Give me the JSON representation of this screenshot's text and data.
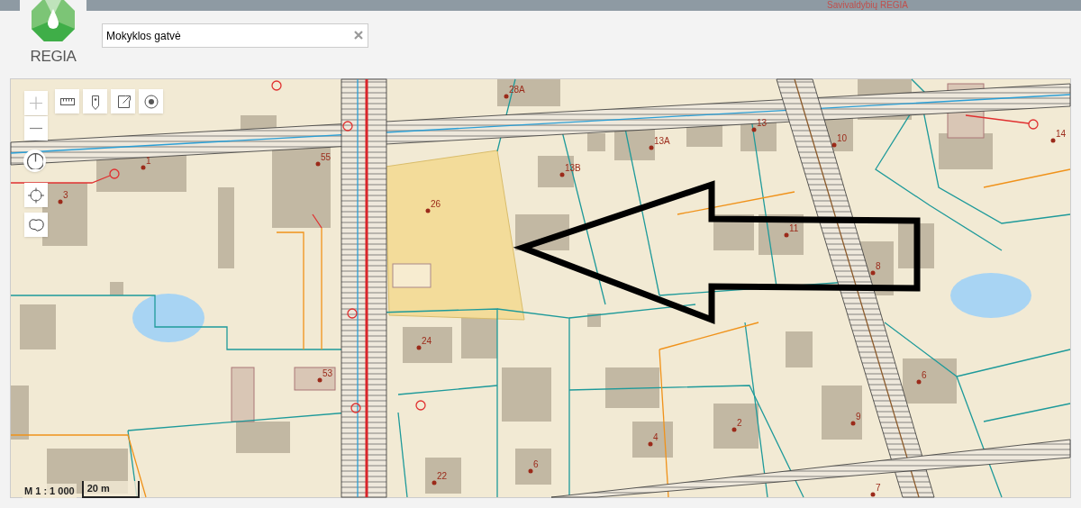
{
  "header": {
    "title": "Savivaldybių REGIA"
  },
  "logo": {
    "text": "REGIA"
  },
  "search": {
    "value": "Mokyklos gatvė"
  },
  "map": {
    "house_numbers": [
      "28A",
      "13",
      "13A",
      "10",
      "14",
      "1",
      "55",
      "3",
      "13B",
      "26",
      "11",
      "8",
      "24",
      "53",
      "6",
      "2",
      "9",
      "4",
      "6",
      "22",
      "7"
    ],
    "scale": {
      "ratio": "M 1 : 1 000",
      "bar": "20 m"
    }
  }
}
